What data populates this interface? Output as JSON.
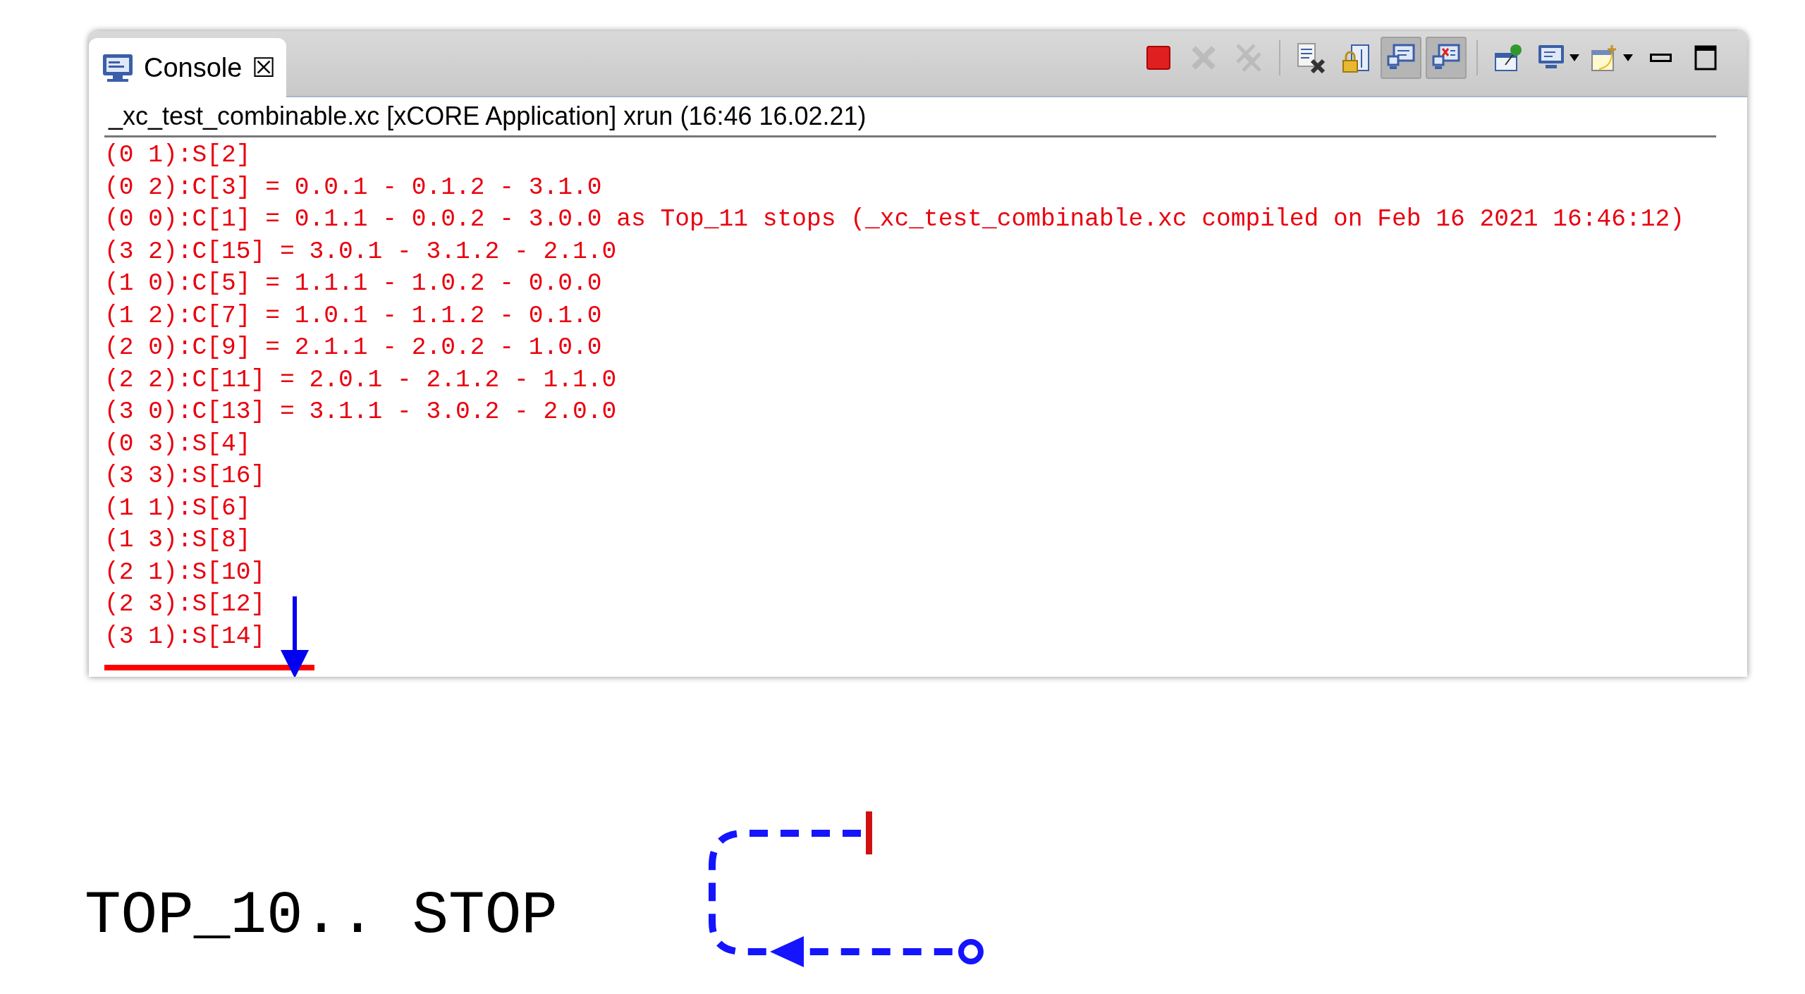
{
  "view_tab": {
    "label": "Console",
    "selected": true,
    "close": "☒"
  },
  "toolbar": [
    {
      "kind": "terminate",
      "disabled": false,
      "selected": false
    },
    {
      "kind": "remove",
      "disabled": true,
      "selected": false
    },
    {
      "kind": "remove-all",
      "disabled": true,
      "selected": false
    },
    {
      "kind": "clear",
      "disabled": false,
      "selected": false
    },
    {
      "kind": "scroll-lock",
      "disabled": false,
      "selected": false
    },
    {
      "kind": "show-stdout",
      "disabled": false,
      "selected": true
    },
    {
      "kind": "show-stderr",
      "disabled": false,
      "selected": true
    },
    {
      "kind": "pin",
      "disabled": false,
      "selected": false
    },
    {
      "kind": "display",
      "disabled": false,
      "selected": false,
      "menu": true
    },
    {
      "kind": "open-console",
      "disabled": false,
      "selected": false,
      "menu": true
    },
    {
      "kind": "minimize",
      "disabled": false,
      "selected": false
    },
    {
      "kind": "maximize",
      "disabled": false,
      "selected": false
    }
  ],
  "console": {
    "header": "_xc_test_combinable.xc [xCORE Application] xrun (16:46 16.02.21)",
    "lines": [
      "(0 1):S[2]",
      "(0 2):C[3] = 0.0.1 - 0.1.2 - 3.1.0",
      "(0 0):C[1] = 0.1.1 - 0.0.2 - 3.0.0 as Top_11 stops (_xc_test_combinable.xc compiled on Feb 16 2021 16:46:12)",
      "(3 2):C[15] = 3.0.1 - 3.1.2 - 2.1.0",
      "(1 0):C[5] = 1.1.1 - 1.0.2 - 0.0.0",
      "(1 2):C[7] = 1.0.1 - 1.1.2 - 0.1.0",
      "(2 0):C[9] = 2.1.1 - 2.0.2 - 1.0.0",
      "(2 2):C[11] = 2.0.1 - 2.1.2 - 1.1.0",
      "(3 0):C[13] = 3.1.1 - 3.0.2 - 2.0.0",
      "(0 3):S[4]",
      "(3 3):S[16]",
      "(1 1):S[6]",
      "(1 3):S[8]",
      "(2 1):S[10]",
      "(2 3):S[12]",
      "(3 1):S[14]"
    ]
  },
  "caption": "TOP_10.. STOP"
}
